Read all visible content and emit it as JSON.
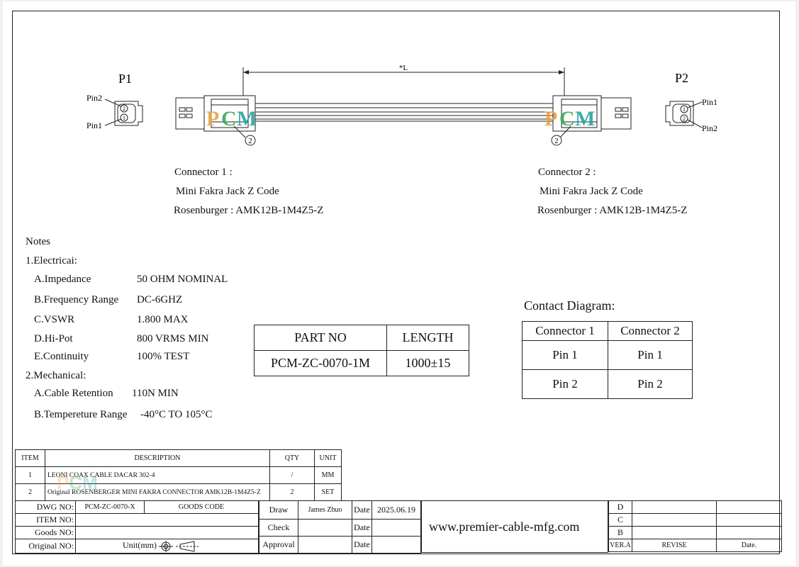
{
  "drawing": {
    "p1_label": "P1",
    "p2_label": "P2",
    "pin1": "Pin1",
    "pin2": "Pin2",
    "length_label": "*L",
    "callout": "2",
    "watermark": "PCM",
    "brand_colors": {
      "P": "#e8a040",
      "C": "#3ea858",
      "M": "#2aa5a0"
    }
  },
  "connector1": {
    "title": "Connector 1 :",
    "type": "Mini Fakra Jack Z Code",
    "part": "Rosenburger : AMK12B-1M4Z5-Z"
  },
  "connector2": {
    "title": "Connector 2 :",
    "type": "Mini Fakra Jack Z Code",
    "part": "Rosenburger : AMK12B-1M4Z5-Z"
  },
  "notes": {
    "title": "Notes",
    "electrical_heading": "1.Electricai:",
    "electrical": [
      {
        "label": "A.Impedance",
        "value": "50 OHM NOMINAL"
      },
      {
        "label": "B.Frequency Range",
        "value": "DC-6GHZ"
      },
      {
        "label": "C.VSWR",
        "value": "1.800 MAX"
      },
      {
        "label": "D.Hi-Pot",
        "value": "800 VRMS MIN"
      },
      {
        "label": "E.Continuity",
        "value": "100% TEST"
      }
    ],
    "mechanical_heading": "2.Mechanical:",
    "mechanical": [
      {
        "label": "A.Cable Retention",
        "value": "110N MIN"
      },
      {
        "label": "B.Tempereture Range",
        "value": "-40°C TO 105°C"
      }
    ]
  },
  "part_table": {
    "headers": [
      "PART NO",
      "LENGTH"
    ],
    "row": [
      "PCM-ZC-0070-1M",
      "1000±15"
    ]
  },
  "contact": {
    "title": "Contact Diagram:",
    "headers": [
      "Connector 1",
      "Connector 2"
    ],
    "rows": [
      [
        "Pin 1",
        "Pin 1"
      ],
      [
        "Pin 2",
        "Pin 2"
      ]
    ]
  },
  "bom": {
    "headers": [
      "ITEM",
      "DESCRIPTION",
      "QTY",
      "UNIT"
    ],
    "rows": [
      [
        "1",
        "LEONI COAX CABLE DACAR 302-4",
        "/",
        "MM"
      ],
      [
        "2",
        "Original ROSENBERGER MINI FAKRA CONNECTOR AMK12B-1M4Z5-Z",
        "2",
        "SET"
      ]
    ]
  },
  "title_block": {
    "dwg_no_label": "DWG NO:",
    "dwg_no": "PCM-ZC-0070-X",
    "goods_code_label": "GOODS CODE",
    "item_no_label": "ITEM NO:",
    "goods_no_label": "Goods NO:",
    "original_no_label": "Original NO:",
    "unit_label": "Unit(mm)",
    "draw_label": "Draw",
    "draw_name": "James Zhuo",
    "date_label": "Date",
    "draw_date": "2025.06.19",
    "check_label": "Check",
    "approval_label": "Approval",
    "website": "www.premier-cable-mfg.com",
    "revisions": [
      "D",
      "C",
      "B"
    ],
    "ver_label": "VER.A",
    "revise_label": "REVISE",
    "date_col_label": "Date."
  }
}
